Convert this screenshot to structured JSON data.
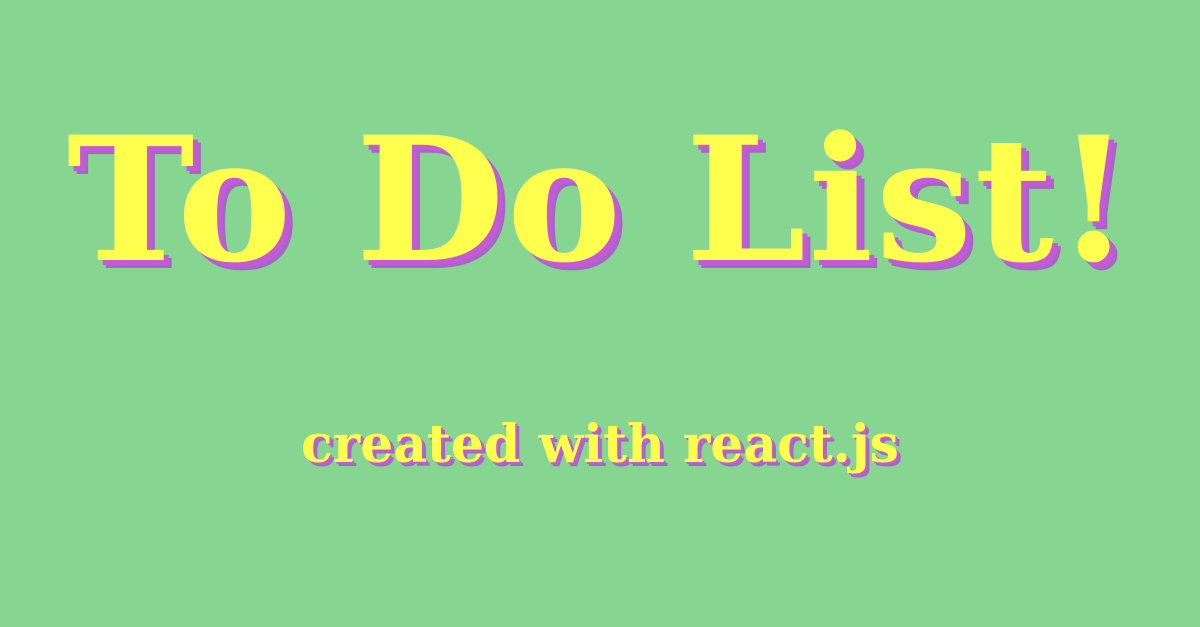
{
  "banner": {
    "title": "To Do List!",
    "subtitle": "created with react.js"
  },
  "colors": {
    "background": "#86d692",
    "text": "#ffff4d",
    "shadow": "#c45ad8"
  }
}
